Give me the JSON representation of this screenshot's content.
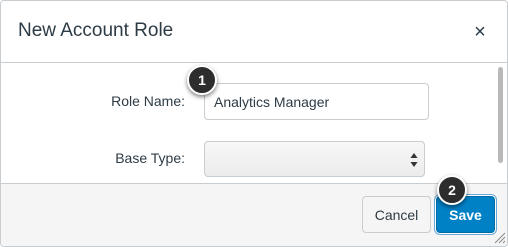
{
  "dialog": {
    "title": "New Account Role",
    "close_symbol": "×"
  },
  "form": {
    "role_name_label": "Role Name:",
    "role_name_value": "Analytics Manager",
    "base_type_label": "Base Type:",
    "base_type_value": ""
  },
  "footer": {
    "cancel_label": "Cancel",
    "save_label": "Save"
  },
  "callouts": [
    "1",
    "2"
  ],
  "colors": {
    "primary": "#0081c6",
    "text": "#2d3b45",
    "border": "#c7cdd1"
  },
  "icons": {
    "close": "close-icon",
    "select_arrows": "updown-arrows-icon",
    "resize": "resize-grip-icon"
  }
}
